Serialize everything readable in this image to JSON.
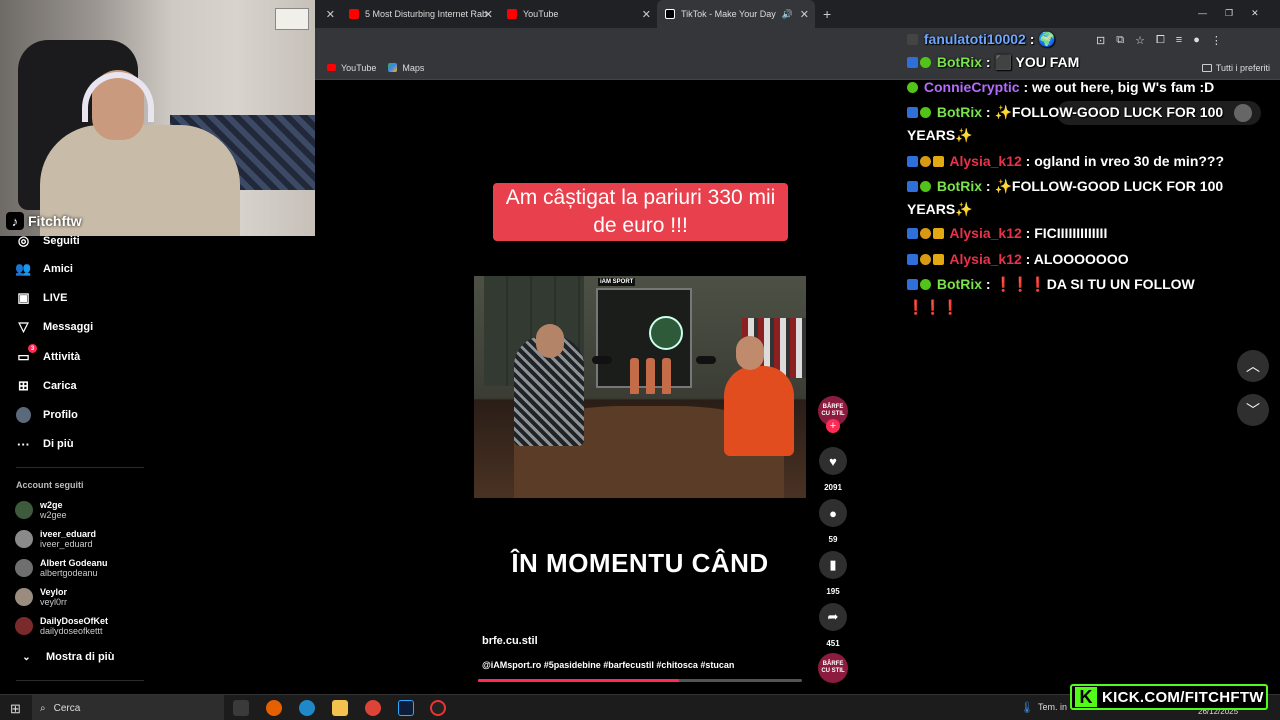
{
  "browser": {
    "tabs": [
      {
        "label": "5 Most Disturbing Internet Rab"
      },
      {
        "label": "YouTube"
      },
      {
        "label": "TikTok - Make Your Day"
      }
    ],
    "bookmarks": [
      {
        "label": "YouTube"
      },
      {
        "label": "Maps"
      }
    ],
    "bookmarks_right": "Tutti i preferiti"
  },
  "webcam": {
    "streamer": "Fitchftw"
  },
  "sidebar": {
    "nav": [
      {
        "label": "Seguiti",
        "icon": "following-icon"
      },
      {
        "label": "Amici",
        "icon": "friends-icon"
      },
      {
        "label": "LIVE",
        "icon": "live-icon"
      },
      {
        "label": "Messaggi",
        "icon": "messages-icon"
      },
      {
        "label": "Attività",
        "icon": "activity-icon",
        "badge": "3"
      },
      {
        "label": "Carica",
        "icon": "upload-icon"
      },
      {
        "label": "Profilo",
        "icon": "profile-icon"
      },
      {
        "label": "Di più",
        "icon": "more-icon"
      }
    ],
    "followed_title": "Account seguiti",
    "followed": [
      {
        "name": "w2ge",
        "handle": "w2gee"
      },
      {
        "name": "iveer_eduard",
        "handle": "iveer_eduard"
      },
      {
        "name": "Albert Godeanu",
        "handle": "albertgodeanu"
      },
      {
        "name": "Veylor",
        "handle": "veyl0rr"
      },
      {
        "name": "DailyDoseOfKet",
        "handle": "dailydoseofkettt"
      }
    ],
    "show_more": "Mostra di più"
  },
  "video": {
    "caption_top": "Am câștigat la pariuri 330 mii de euro !!!",
    "caption_mid": "ÎN MOMENTU CÂND",
    "scene_brand": "iAM SPORT",
    "author": "brfe.cu.stil",
    "description": "@iAMsport.ro #5pasidebine #barfecustil #chitosca #stucan",
    "progress": 0.62,
    "creator_badge": "BÂRFE CU STIL"
  },
  "actions": {
    "likes": "2091",
    "comments": "59",
    "saves": "195",
    "shares": "451"
  },
  "chat": [
    {
      "user": "fanulatoti10002",
      "color": "#6ea7ff",
      "badges": [
        "avatar"
      ],
      "msg": ": 🌍"
    },
    {
      "user": "BotRix",
      "color": "#7ae34a",
      "badges": [
        "mod",
        "ver"
      ],
      "msg": ": ⬛ YOU FAM"
    },
    {
      "user": "ConnieCryptic",
      "color": "#b46bff",
      "badges": [
        "ver"
      ],
      "msg": ": we out here, big W's fam :D"
    },
    {
      "user": "BotRix",
      "color": "#7ae34a",
      "badges": [
        "mod",
        "ver"
      ],
      "msg": ": ✨FOLLOW-GOOD LUCK FOR 100 YEARS✨"
    },
    {
      "user": "Alysia_k12",
      "color": "#e8324a",
      "badges": [
        "mod",
        "sub",
        "og"
      ],
      "msg": ": ogland in vreo 30 de min???"
    },
    {
      "user": "BotRix",
      "color": "#7ae34a",
      "badges": [
        "mod",
        "ver"
      ],
      "msg": ": ✨FOLLOW-GOOD LUCK FOR 100 YEARS✨"
    },
    {
      "user": "Alysia_k12",
      "color": "#e8324a",
      "badges": [
        "mod",
        "sub",
        "og"
      ],
      "msg": ": FICIIIIIIIIIIIII"
    },
    {
      "user": "Alysia_k12",
      "color": "#e8324a",
      "badges": [
        "mod",
        "sub",
        "og"
      ],
      "msg": ": ALOOOOOOO"
    },
    {
      "user": "BotRix",
      "color": "#7ae34a",
      "badges": [
        "mod",
        "ver"
      ],
      "msg": ": ❗❗❗DA SI TU UN FOLLOW ❗❗❗"
    }
  ],
  "taskbar": {
    "search_placeholder": "Cerca",
    "weather": "Tem. in",
    "date": "26/12/2025"
  },
  "kick_banner": "KICK.COM/FITCHFTW",
  "colors": {
    "tiktok_red": "#fe2c55",
    "kick_green": "#53fc18",
    "caption_red": "#e8404d"
  }
}
